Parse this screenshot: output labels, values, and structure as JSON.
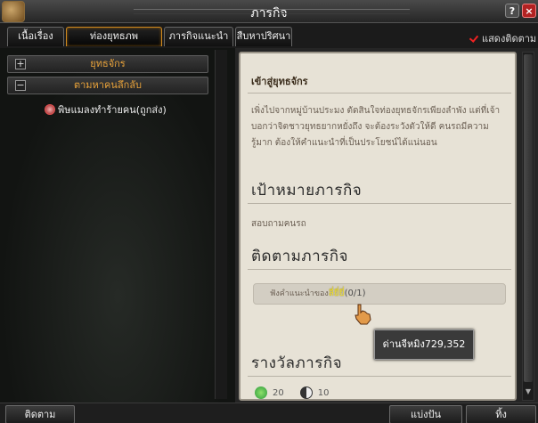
{
  "window": {
    "title": "ภารกิจ",
    "help_label": "?",
    "close_label": "×"
  },
  "tabs": [
    {
      "label": "เนื้อเรื่อง",
      "active": false
    },
    {
      "label": "ท่องยุทธภพ",
      "active": true
    },
    {
      "label": "ภารกิจแนะนำ",
      "active": false
    },
    {
      "label": "สืบหาปริศนา",
      "active": false
    }
  ],
  "track_toggle": {
    "label": "แสดงติดตาม",
    "checked": true
  },
  "left": {
    "categories": [
      {
        "toggle": "+",
        "label": "ยุทธจักร"
      },
      {
        "toggle": "−",
        "label": "ตามหาคนลึกลับ"
      }
    ],
    "quests": [
      {
        "label": "พิษแมลงทำร้ายคน(ถูกส่ง)"
      }
    ]
  },
  "detail": {
    "title": "เข้าสู่ยุทธจักร",
    "description": "เพิ่งไปจากหมู่บ้านประมง ตัดสินใจท่องยุทธจักรเพียงลำพัง แต่ที่เจ้าบอกว่าจิตชาวยุทธยากหยั่งถึง จะต้องระวังตัวให้ดี คนรถมีความรู้มาก ต้องให้คำแนะนำที่เป็นประโยชน์ได้แน่นอน",
    "goal_heading": "เป้าหมายภารกิจ",
    "goal_text": "สอบถามคนรถ",
    "track_heading": "ติดตามภารกิจ",
    "track_prefix": "ฟังคำแนะนำของ",
    "track_npc": "ลี่ยี่ยี่",
    "track_progress": "(0/1)",
    "tooltip": "ด่านจีหมิง729,352",
    "reward_heading": "รางวัลภารกิจ",
    "rewards": [
      {
        "icon": "exp-icon",
        "value": "20",
        "color": "#2c9a3c"
      },
      {
        "icon": "yinyang-icon",
        "value": "10",
        "color": "#333333"
      }
    ]
  },
  "bottom": {
    "track_button": "ติดตาม",
    "share_button": "แบ่งปัน",
    "abandon_button": "ทิ้ง"
  },
  "colors": {
    "accent": "#e8a23a",
    "tab_active_border": "#d0891e",
    "npc_highlight": "#f2e23a"
  }
}
